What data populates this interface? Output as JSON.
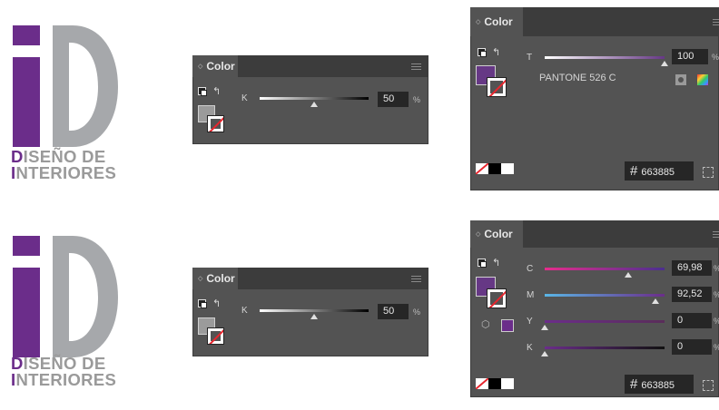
{
  "colors": {
    "brand_purple": "#6b2d8a",
    "brand_gray": "#a6a8ab",
    "panel_bg": "#535353",
    "field_bg": "#262626",
    "pantone_fill": "#663885"
  },
  "logo": {
    "line1_first": "D",
    "line1_rest": "ISEÑO DE",
    "line2_first": "I",
    "line2_rest": "NTERIORES"
  },
  "panels": {
    "tab_label": "Color",
    "gray": {
      "k_label": "K",
      "k_value": "50",
      "k_fraction": 0.5,
      "percent": "%"
    },
    "tint": {
      "t_label": "T",
      "t_value": "100",
      "t_fraction": 1.0,
      "percent": "%",
      "swatch_name": "PANTONE 526 C",
      "hex_symbol": "#",
      "hex_value": "663885"
    },
    "cmyk": {
      "c_label": "C",
      "c_value": "69,98",
      "c_fraction": 0.6998,
      "m_label": "M",
      "m_value": "92,52",
      "m_fraction": 0.9252,
      "y_label": "Y",
      "y_value": "0",
      "y_fraction": 0,
      "k_label": "K",
      "k_value": "0",
      "k_fraction": 0,
      "percent": "%",
      "hex_symbol": "#",
      "hex_value": "663885"
    }
  }
}
